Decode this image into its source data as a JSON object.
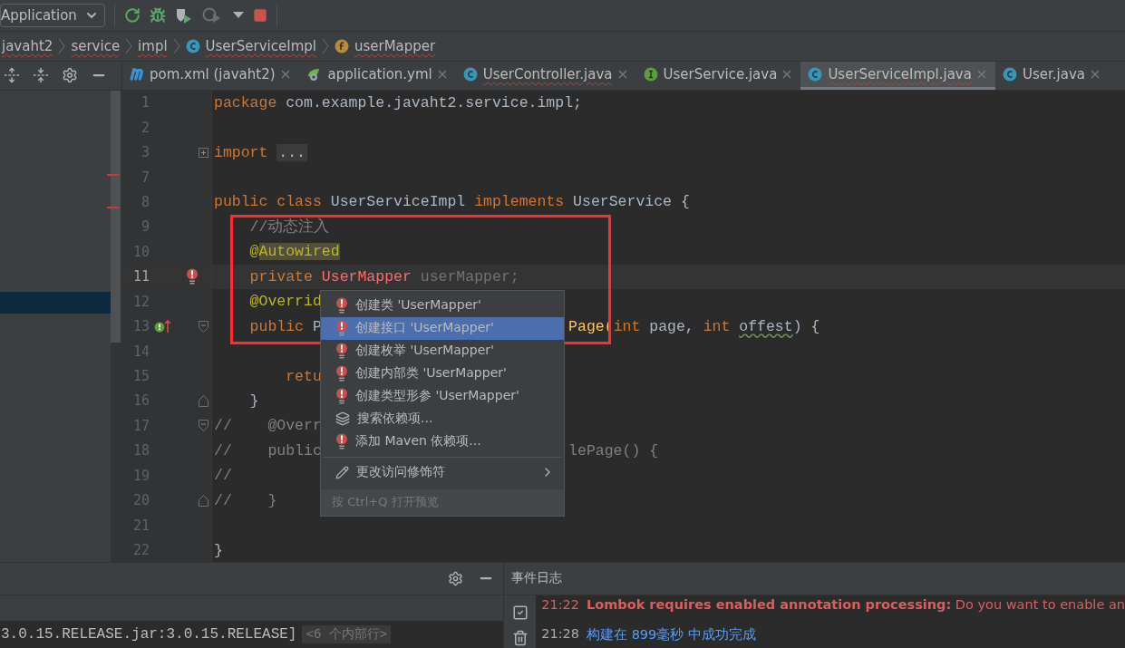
{
  "toolbar": {
    "run_config": "Application"
  },
  "breadcrumbs": [
    {
      "label": "javaht2",
      "kind": "package",
      "error": true
    },
    {
      "label": "service",
      "kind": "package",
      "error": true
    },
    {
      "label": "impl",
      "kind": "package",
      "error": true
    },
    {
      "label": "UserServiceImpl",
      "kind": "class",
      "error": true
    },
    {
      "label": "userMapper",
      "kind": "field",
      "error": true
    }
  ],
  "tabs": [
    {
      "label": "pom.xml (javaht2)",
      "kind": "maven",
      "selected": false,
      "error": false
    },
    {
      "label": "application.yml",
      "kind": "spring",
      "selected": false,
      "error": false
    },
    {
      "label": "UserController.java",
      "kind": "class",
      "selected": false,
      "error": true
    },
    {
      "label": "UserService.java",
      "kind": "interface",
      "selected": false,
      "error": false
    },
    {
      "label": "UserServiceImpl.java",
      "kind": "class",
      "selected": true,
      "error": true
    },
    {
      "label": "User.java",
      "kind": "class",
      "selected": false,
      "error": false
    }
  ],
  "editor": {
    "lines": [
      {
        "number": "1",
        "current": false,
        "tokens": [
          {
            "kind": "kw",
            "text": "package"
          },
          {
            "kind": "plain",
            "text": " com.example.javaht2.service.impl;"
          }
        ]
      },
      {
        "number": "2",
        "current": false
      },
      {
        "number": "3",
        "current": false,
        "icons": [
          {
            "kind": "fold-collapsed"
          }
        ],
        "tokens": [
          {
            "kind": "kw",
            "text": "import"
          },
          {
            "kind": "folded",
            "text": "..."
          }
        ]
      },
      {
        "number": "7",
        "current": false
      },
      {
        "number": "8",
        "current": false,
        "tokens": [
          {
            "kind": "kw",
            "text": "public class "
          },
          {
            "kind": "plain",
            "text": "UserServiceImpl "
          },
          {
            "kind": "kw",
            "text": "implements "
          },
          {
            "kind": "plain",
            "text": "UserService {"
          }
        ]
      },
      {
        "number": "9",
        "current": false,
        "tokens": [
          {
            "kind": "comment",
            "text": "    //动态注入"
          }
        ]
      },
      {
        "number": "10",
        "current": false,
        "tokens": [
          {
            "kind": "annotation",
            "text": "    @"
          },
          {
            "kind": "annotation-hl",
            "text": "Autowired"
          }
        ]
      },
      {
        "number": "11",
        "current": true,
        "icons": [
          {
            "kind": "error-bulb"
          }
        ],
        "tokens": [
          {
            "kind": "kw",
            "text": "    private "
          },
          {
            "kind": "unresolved",
            "text": "UserMapper"
          },
          {
            "kind": "unused",
            "text": " userMapper;"
          }
        ]
      },
      {
        "number": "12",
        "current": false,
        "tokens": [
          {
            "kind": "annotation",
            "text": "    @Overrid"
          }
        ]
      },
      {
        "number": "13",
        "current": false,
        "icons": [
          {
            "kind": "override"
          },
          {
            "kind": "fold-start"
          }
        ],
        "tokens": [
          {
            "kind": "kw",
            "text": "    public "
          },
          {
            "kind": "plain",
            "text": "P"
          }
        ],
        "right": [
          {
            "kind": "method",
            "text": "Page("
          },
          {
            "kind": "kw",
            "text": "int"
          },
          {
            "kind": "plain",
            "text": " page, "
          },
          {
            "kind": "kw",
            "text": "int"
          },
          {
            "kind": "typo",
            "text": "offest"
          },
          {
            "kind": "plain",
            "text": ") {"
          }
        ]
      },
      {
        "number": "14",
        "current": false
      },
      {
        "number": "15",
        "current": false,
        "tokens": [
          {
            "kind": "kw",
            "text": "        retu"
          }
        ]
      },
      {
        "number": "16",
        "current": false,
        "icons": [
          {
            "kind": "fold-end"
          }
        ],
        "tokens": [
          {
            "kind": "plain",
            "text": "    }"
          }
        ]
      },
      {
        "number": "17",
        "current": false,
        "icons": [
          {
            "kind": "fold-start"
          }
        ],
        "tokens": [
          {
            "kind": "comment",
            "text": "//    @Overr"
          }
        ]
      },
      {
        "number": "18",
        "current": false,
        "tokens": [
          {
            "kind": "comment",
            "text": "//    public"
          }
        ],
        "right": [
          {
            "kind": "comment",
            "text": "lePage() {"
          }
        ]
      },
      {
        "number": "19",
        "current": false,
        "tokens": [
          {
            "kind": "comment",
            "text": "//"
          }
        ]
      },
      {
        "number": "20",
        "current": false,
        "icons": [
          {
            "kind": "fold-end"
          }
        ],
        "tokens": [
          {
            "kind": "comment",
            "text": "//    }"
          }
        ]
      },
      {
        "number": "21",
        "current": false
      },
      {
        "number": "22",
        "current": false,
        "tokens": [
          {
            "kind": "plain",
            "text": "}"
          }
        ]
      }
    ]
  },
  "intention_menu": {
    "groups": [
      [
        {
          "label": "创建类 'UserMapper'",
          "kind": "error-bulb",
          "selected": false,
          "submenu": false
        },
        {
          "label": "创建接口 'UserMapper'",
          "kind": "error-bulb",
          "selected": true,
          "submenu": false
        },
        {
          "label": "创建枚举 'UserMapper'",
          "kind": "error-bulb",
          "selected": false,
          "submenu": false
        },
        {
          "label": "创建内部类 'UserMapper'",
          "kind": "error-bulb",
          "selected": false,
          "submenu": false
        },
        {
          "label": "创建类型形参 'UserMapper'",
          "kind": "error-bulb",
          "selected": false,
          "submenu": false
        },
        {
          "label": "搜索依赖项...",
          "kind": "layers",
          "selected": false,
          "submenu": false
        },
        {
          "label": "添加 Maven 依赖项...",
          "kind": "error-bulb",
          "selected": false,
          "submenu": false
        }
      ],
      [
        {
          "label": "更改访问修饰符",
          "kind": "pencil",
          "selected": false,
          "submenu": true
        }
      ]
    ],
    "hint": "按 Ctrl+Q 打开预览"
  },
  "console": {
    "text": "3.0.15.RELEASE.jar:3.0.15.RELEASE]",
    "folded": "<6 个内部行>"
  },
  "event_log": {
    "title": "事件日志",
    "entries": [
      {
        "time": "21:22",
        "text": "**Lombok requires enabled annotation processing:** Do you want to enable an",
        "kind": "error"
      },
      {
        "time": "21:28",
        "text": "构建在 899毫秒 中成功完成",
        "kind": "link"
      }
    ]
  }
}
